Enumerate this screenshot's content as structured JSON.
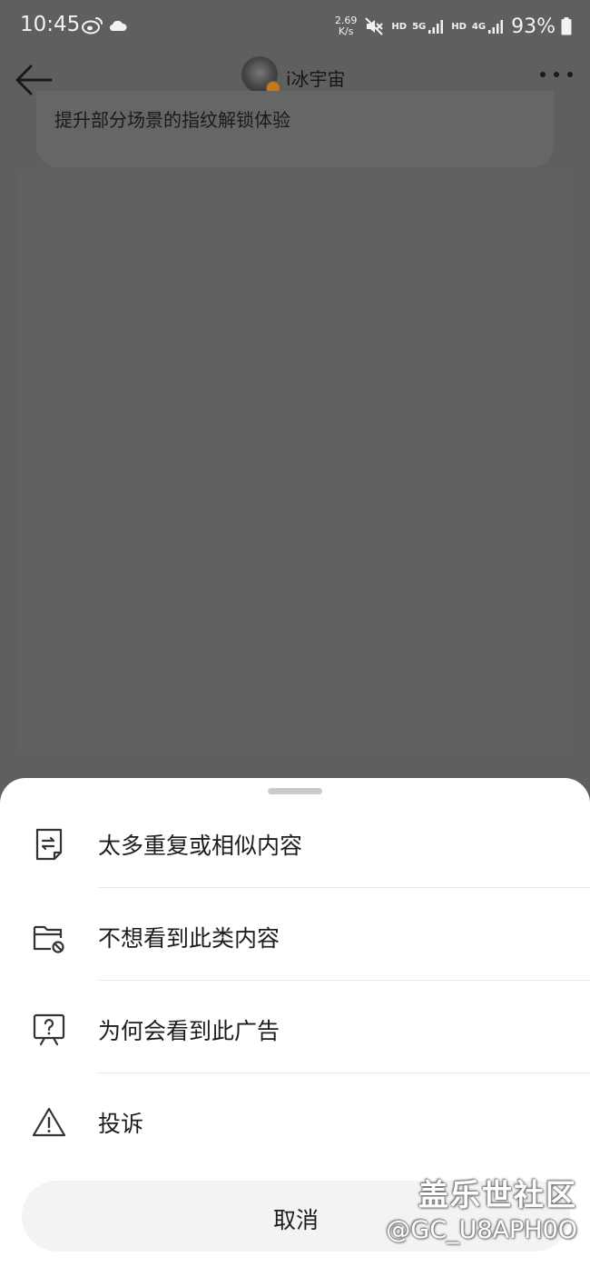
{
  "status_bar": {
    "time": "10:45",
    "net_speed_value": "2.69",
    "net_speed_unit": "K/s",
    "hd_label_1": "HD",
    "net_label_1": "5G",
    "hd_label_2": "HD",
    "net_label_2": "4G",
    "battery": "93%"
  },
  "header": {
    "title": "i冰宇宙"
  },
  "content": {
    "card_text": "提升部分场景的指纹解锁体验"
  },
  "sheet": {
    "items": [
      {
        "label": "太多重复或相似内容",
        "icon": "repeat-doc-icon"
      },
      {
        "label": "不想看到此类内容",
        "icon": "folder-block-icon"
      },
      {
        "label": "为何会看到此广告",
        "icon": "question-board-icon"
      },
      {
        "label": "投诉",
        "icon": "warning-icon"
      }
    ],
    "cancel_label": "取消"
  },
  "watermark": {
    "title": "盖乐世社区",
    "user": "@GC_U8APH0O"
  },
  "colors": {
    "overlay": "#5f5f5f",
    "sheet_bg": "#ffffff",
    "cancel_bg": "#f3f3f3",
    "badge": "#c77a12"
  }
}
